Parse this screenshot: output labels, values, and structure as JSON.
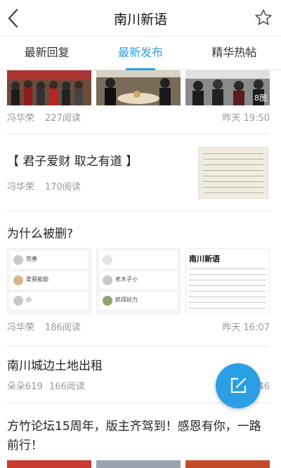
{
  "header": {
    "title": "南川新语"
  },
  "tabs": [
    {
      "label": "最新回复"
    },
    {
      "label": "最新发布"
    },
    {
      "label": "精华热帖"
    }
  ],
  "posts": [
    {
      "author": "冯华荣",
      "views": "227阅读",
      "time": "昨天 19:50",
      "image_count": "8图"
    },
    {
      "title": "【 君子爱财 取之有道 】",
      "author": "冯华荣",
      "views": "170阅读"
    },
    {
      "title": "为什么被删?",
      "author": "冯华荣",
      "views": "186阅读",
      "time": "昨天 16:07",
      "shot1_rows": [
        "完善",
        "爱莫能助",
        "小"
      ],
      "shot2_rows": [
        "老木子小",
        "抓得好力"
      ],
      "excerpt_heading": "南川新语"
    },
    {
      "title": "南川城边土地出租",
      "author": "朵朵619",
      "views": "166阅读",
      "time_partial": "46"
    },
    {
      "title": "方竹论坛15周年，版主齐驾到！感恩有你，一路前行！"
    }
  ],
  "colors": {
    "accent": "#2a9fe6"
  },
  "icons": {
    "back": "chevron-left-icon",
    "favorite": "star-icon",
    "compose": "edit-icon"
  }
}
